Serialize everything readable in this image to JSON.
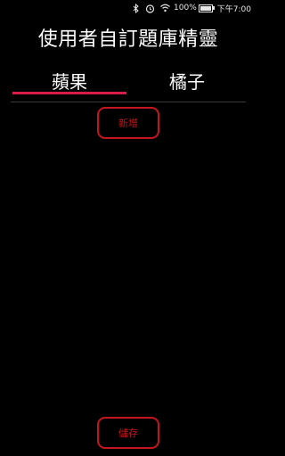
{
  "status_bar": {
    "battery_percent": "100%",
    "time": "下午7:00",
    "icons": [
      "bluetooth-icon",
      "alarm-icon",
      "wifi-icon",
      "battery-icon"
    ]
  },
  "header": {
    "title": "使用者自訂題庫精靈"
  },
  "tabs": [
    {
      "label": "蘋果",
      "selected": true
    },
    {
      "label": "橘子",
      "selected": false
    }
  ],
  "actions": {
    "add_label": "新增",
    "save_label": "儲存"
  },
  "colors": {
    "accent": "#c4161c",
    "tab_indicator": "#d81b47",
    "background": "#000000"
  }
}
